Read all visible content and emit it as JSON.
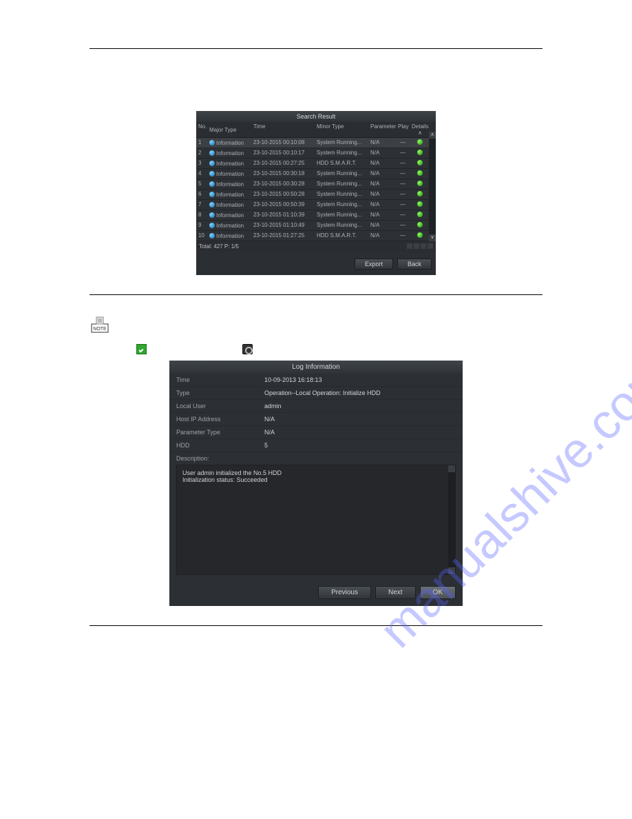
{
  "shot1": {
    "title": "Search Result",
    "headers": {
      "no": "No.",
      "major": "Major Type",
      "time": "Time",
      "minor": "Minor Type",
      "param": "Parameter",
      "play": "Play",
      "details": "Details"
    },
    "rows": [
      {
        "no": "1",
        "major": "Information",
        "time": "23-10-2015 00:10:08",
        "minor": "System Running...",
        "param": "N/A",
        "play": "—"
      },
      {
        "no": "2",
        "major": "Information",
        "time": "23-10-2015 00:10:17",
        "minor": "System Running...",
        "param": "N/A",
        "play": "—"
      },
      {
        "no": "3",
        "major": "Information",
        "time": "23-10-2015 00:27:25",
        "minor": "HDD S.M.A.R.T.",
        "param": "N/A",
        "play": "—"
      },
      {
        "no": "4",
        "major": "Information",
        "time": "23-10-2015 00:30:18",
        "minor": "System Running...",
        "param": "N/A",
        "play": "—"
      },
      {
        "no": "5",
        "major": "Information",
        "time": "23-10-2015 00:30:28",
        "minor": "System Running...",
        "param": "N/A",
        "play": "—"
      },
      {
        "no": "6",
        "major": "Information",
        "time": "23-10-2015 00:50:28",
        "minor": "System Running...",
        "param": "N/A",
        "play": "—"
      },
      {
        "no": "7",
        "major": "Information",
        "time": "23-10-2015 00:50:39",
        "minor": "System Running...",
        "param": "N/A",
        "play": "—"
      },
      {
        "no": "8",
        "major": "Information",
        "time": "23-10-2015 01:10:39",
        "minor": "System Running...",
        "param": "N/A",
        "play": "—"
      },
      {
        "no": "9",
        "major": "Information",
        "time": "23-10-2015 01:10:49",
        "minor": "System Running...",
        "param": "N/A",
        "play": "—"
      },
      {
        "no": "10",
        "major": "Information",
        "time": "23-10-2015 01:27:25",
        "minor": "HDD S.M.A.R.T.",
        "param": "N/A",
        "play": "—"
      }
    ],
    "totals": "Total: 427  P: 1/5",
    "buttons": {
      "export": "Export",
      "back": "Back"
    }
  },
  "shot2": {
    "title": "Log Information",
    "fields": {
      "time_k": "Time",
      "time_v": "10-09-2013 16:18:13",
      "type_k": "Type",
      "type_v": "Operation--Local Operation: Initialize HDD",
      "user_k": "Local User",
      "user_v": "admin",
      "host_k": "Host IP Address",
      "host_v": "N/A",
      "param_k": "Parameter Type",
      "param_v": "N/A",
      "hdd_k": "HDD",
      "hdd_v": "5"
    },
    "desc_label": "Description:",
    "desc_line1": "User admin initialized the No.5 HDD",
    "desc_line2": "Initialization status: Succeeded",
    "buttons": {
      "prev": "Previous",
      "next": "Next",
      "ok": "OK"
    }
  },
  "watermark": "manualshive.com",
  "note_label": "NOTE"
}
